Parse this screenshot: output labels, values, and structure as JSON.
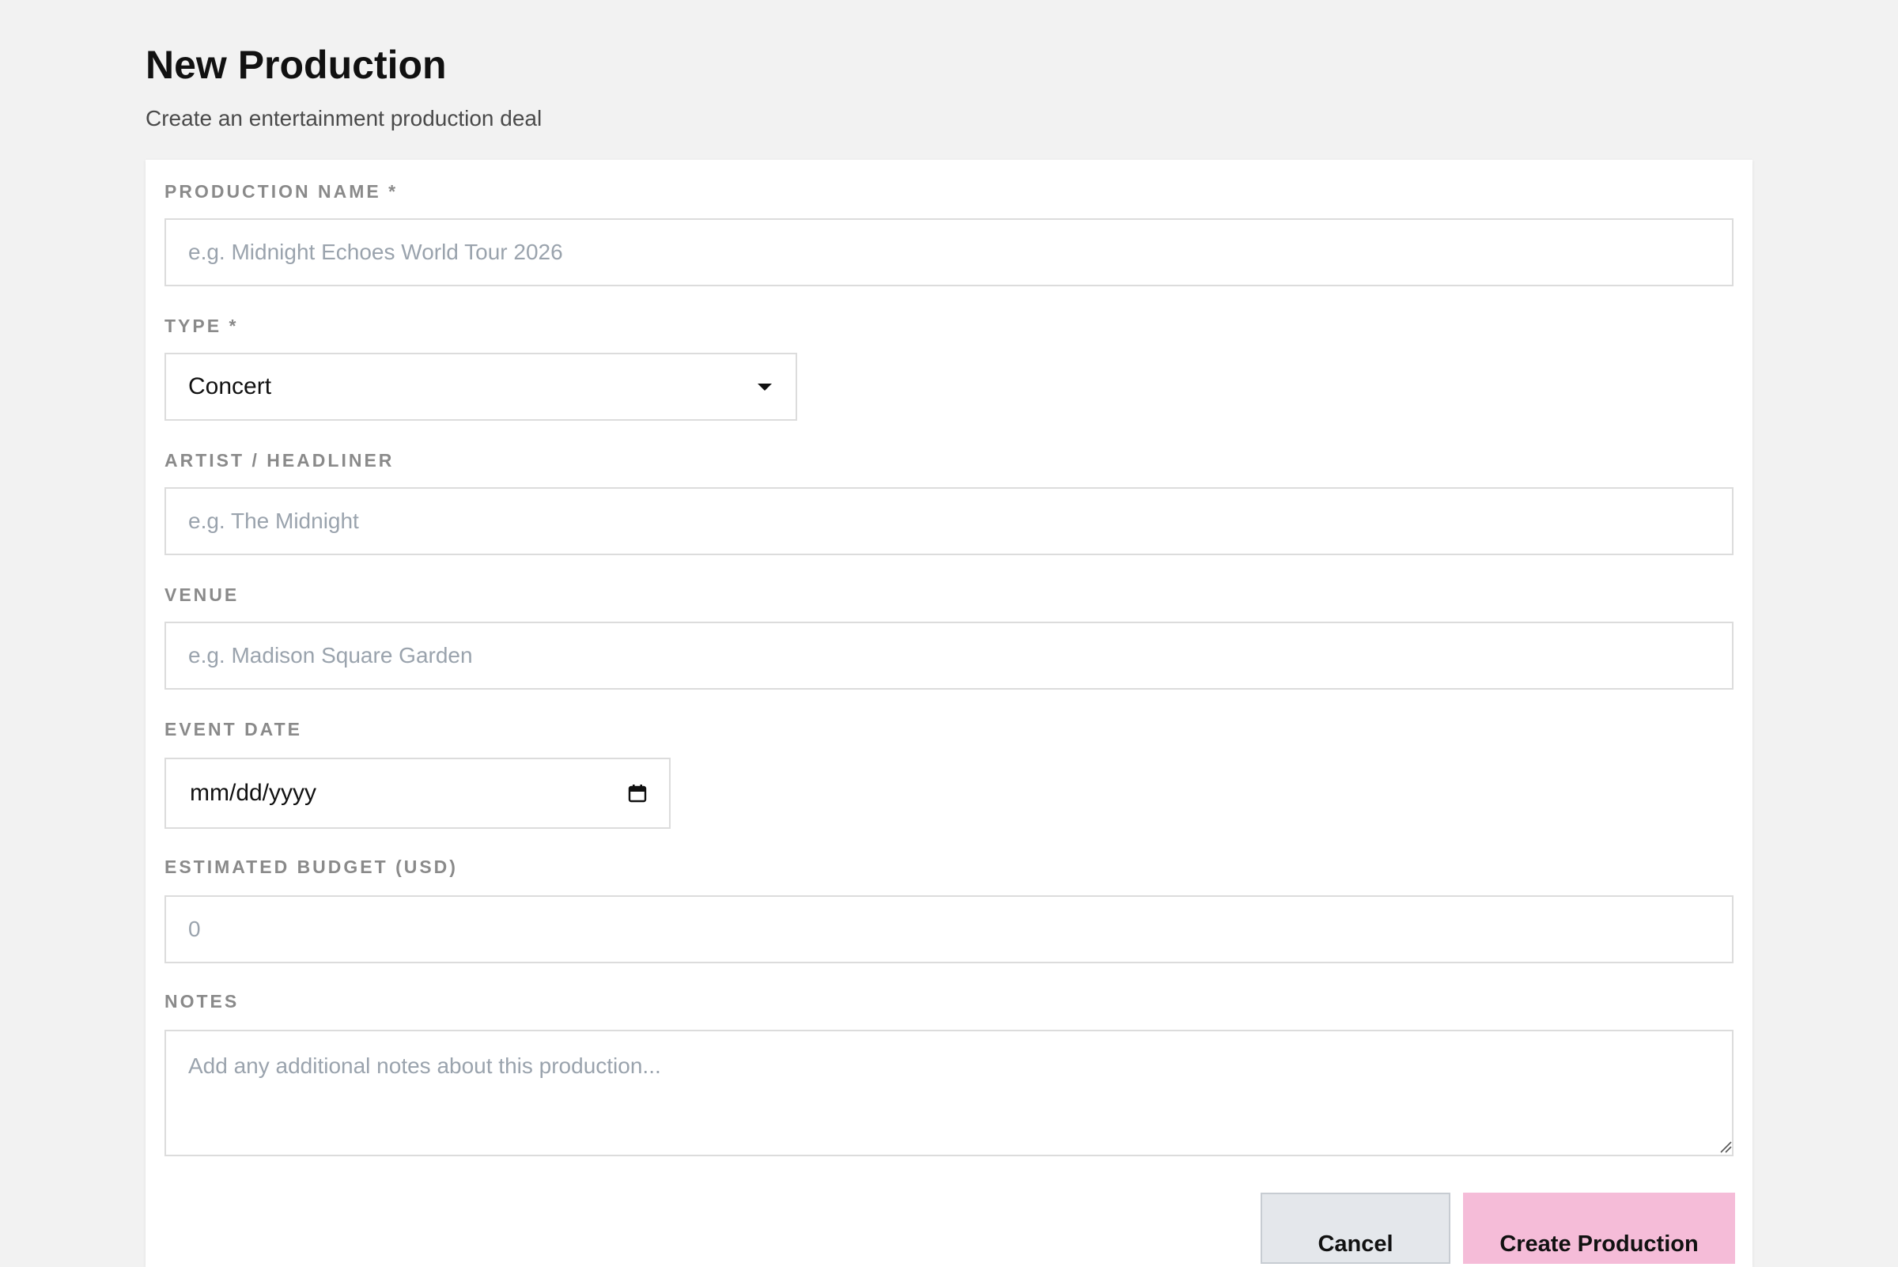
{
  "header": {
    "title": "New Production",
    "subtitle": "Create an entertainment production deal"
  },
  "form": {
    "production_name": {
      "label": "PRODUCTION NAME *",
      "value": "",
      "placeholder": "e.g. Midnight Echoes World Tour 2026"
    },
    "type": {
      "label": "TYPE *",
      "value": "Concert"
    },
    "artist": {
      "label": "ARTIST / HEADLINER",
      "value": "",
      "placeholder": "e.g. The Midnight"
    },
    "venue": {
      "label": "VENUE",
      "value": "",
      "placeholder": "e.g. Madison Square Garden"
    },
    "event_date": {
      "label": "EVENT DATE",
      "value": "mm/dd/yyyy",
      "icon": "calendar-icon"
    },
    "budget": {
      "label": "ESTIMATED BUDGET (USD)",
      "value": "",
      "placeholder": "0"
    },
    "notes": {
      "label": "NOTES",
      "value": "",
      "placeholder": "Add any additional notes about this production..."
    }
  },
  "actions": {
    "cancel_label": "Cancel",
    "create_label": "Create Production"
  },
  "colors": {
    "background": "#f2f2f2",
    "card": "#ffffff",
    "label": "#8a8a8a",
    "placeholder": "#9aa3ad",
    "border": "#dcdcdc",
    "cancel_bg": "#e4e7eb",
    "create_bg": "#f5bcd8"
  }
}
